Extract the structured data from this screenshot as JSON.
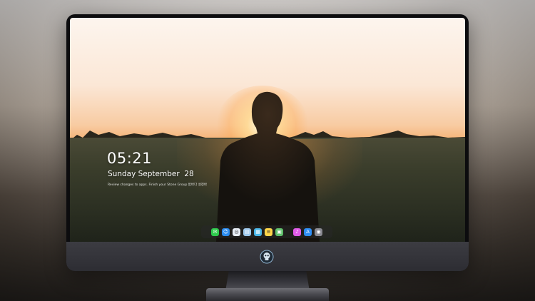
{
  "lockscreen": {
    "time": "05:21",
    "date": "Sunday September  28",
    "notice": "Review changes to apps. Finish your Stone Group 밤바다 설정바"
  },
  "dock": {
    "apps": [
      {
        "icon": "messages-icon",
        "color": "#2fc94d",
        "glyph": "✉"
      },
      {
        "icon": "finder-icon",
        "color": "#2b8cf0",
        "glyph": "☺"
      },
      {
        "icon": "safari-icon",
        "color": "#e8eef6",
        "glyph": "◎"
      },
      {
        "icon": "notes-folder-icon",
        "color": "#9fc9ec",
        "glyph": "▤"
      },
      {
        "icon": "clapper-icon",
        "color": "#49b6e8",
        "glyph": "▦"
      },
      {
        "icon": "notes-icon",
        "color": "#ffd54a",
        "glyph": "≡"
      },
      {
        "icon": "photos-icon",
        "color": "#5fbf6a",
        "glyph": "▣"
      },
      {
        "icon": "music-icon",
        "color": "#e05be8",
        "glyph": "♪"
      },
      {
        "icon": "app-store-icon",
        "color": "#2f8ef5",
        "glyph": "A"
      },
      {
        "icon": "camera-icon",
        "color": "#8a8a92",
        "glyph": "◉"
      }
    ]
  },
  "monitor": {
    "emblem": "skull-logo-icon",
    "frame_color": "#0c0c0e",
    "chin_color": "#333339"
  }
}
